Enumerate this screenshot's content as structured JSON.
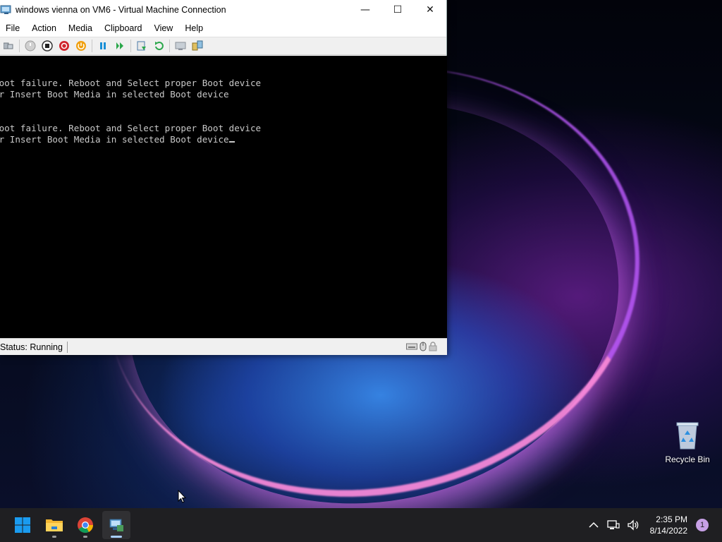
{
  "window": {
    "title": "windows vienna on VM6 - Virtual Machine Connection",
    "minimize_glyph": "—",
    "maximize_glyph": "☐",
    "close_glyph": "✕"
  },
  "menu": {
    "items": [
      "File",
      "Action",
      "Media",
      "Clipboard",
      "View",
      "Help"
    ]
  },
  "toolbar": {
    "icons": [
      "ctrl-alt-del-icon",
      "start-icon",
      "turn-off-icon",
      "shut-down-icon",
      "save-icon",
      "pause-icon",
      "resume-icon",
      "checkpoint-icon",
      "revert-icon",
      "enhanced-session-icon",
      "share-icon"
    ]
  },
  "console": {
    "lines": [
      "Boot failure. Reboot and Select proper Boot device",
      "or Insert Boot Media in selected Boot device",
      "",
      "",
      "Boot failure. Reboot and Select proper Boot device",
      "or Insert Boot Media in selected Boot device"
    ]
  },
  "status": {
    "text": "Status: Running"
  },
  "desktop": {
    "recycle_bin_label": "Recycle Bin"
  },
  "taskbar": {
    "apps": [
      "start-icon",
      "file-explorer-icon",
      "chrome-icon",
      "vm-connection-icon"
    ],
    "time": "2:35 PM",
    "date": "8/14/2022",
    "notification_count": "1"
  },
  "colors": {
    "console_text": "#c8c8c8",
    "taskbar_bg": "#1f1f22",
    "start_blue": "#1a9bf0"
  }
}
